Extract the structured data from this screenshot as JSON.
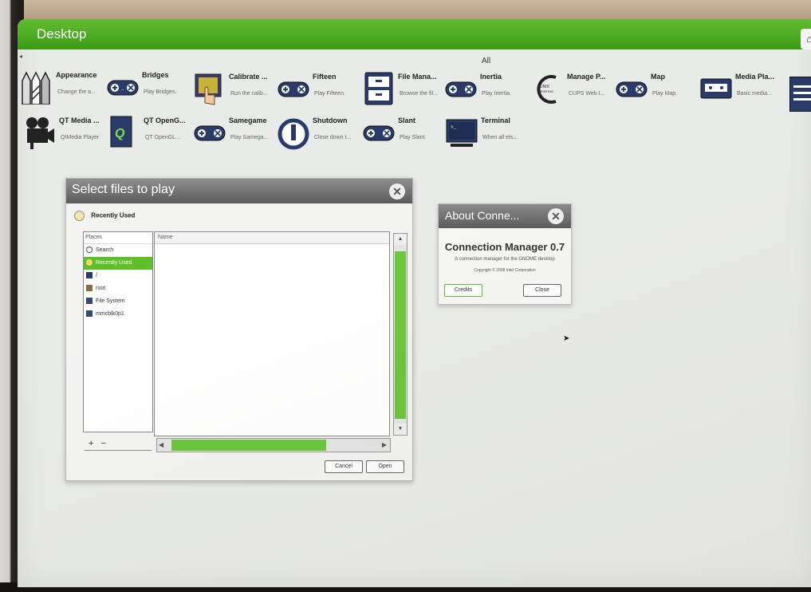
{
  "topbar": {
    "title": "Desktop",
    "right_button": "⌂"
  },
  "category": "All",
  "apps": [
    {
      "name": "Appearance",
      "desc": "Change the a...",
      "icon": "appearance-icon"
    },
    {
      "name": "Bridges",
      "desc": "Play Bridges.",
      "icon": "gamepad-icon"
    },
    {
      "name": "Calibrate ...",
      "desc": "Run the calib...",
      "icon": "calibrate-icon"
    },
    {
      "name": "Fifteen",
      "desc": "Play Fifteen.",
      "icon": "gamepad-icon"
    },
    {
      "name": "File Mana...",
      "desc": "Browse the fil...",
      "icon": "file-cabinet-icon"
    },
    {
      "name": "Inertia",
      "desc": "Play Inertia.",
      "icon": "gamepad-icon"
    },
    {
      "name": "Manage P...",
      "desc": "CUPS Web I...",
      "icon": "printing-system-icon"
    },
    {
      "name": "Map",
      "desc": "Play Map.",
      "icon": "gamepad-icon"
    },
    {
      "name": "Media Pla...",
      "desc": "Basic media...",
      "icon": "media-player-icon"
    },
    {
      "name": "QT Media ...",
      "desc": "QtMedia Player",
      "icon": "camera-icon"
    },
    {
      "name": "QT OpenG...",
      "desc": "QT OpenGL...",
      "icon": "opengl-icon"
    },
    {
      "name": "Samegame",
      "desc": "Play Samega...",
      "icon": "gamepad-icon"
    },
    {
      "name": "Shutdown",
      "desc": "Close down t...",
      "icon": "power-icon"
    },
    {
      "name": "Slant",
      "desc": "Play Slant.",
      "icon": "gamepad-icon"
    },
    {
      "name": "Terminal",
      "desc": "When all els...",
      "icon": "terminal-icon"
    }
  ],
  "file_dialog": {
    "title": "Select files to play",
    "location": "Recently Used",
    "places_header": "Places",
    "places": [
      "Search",
      "Recently Used",
      "/",
      "root",
      "File System",
      "mmcblk0p1"
    ],
    "selected_place": "Recently Used",
    "column_name": "Name",
    "add_label": "+",
    "remove_label": "−",
    "cancel_label": "Cancel",
    "open_label": "Open"
  },
  "about_dialog": {
    "title": "About Conne...",
    "app_name": "Connection Manager 0.7",
    "description": "A connection manager for the GNOME desktop",
    "copyright": "Copyright © 2008 Intel Corporation",
    "credits_label": "Credits",
    "close_label": "Close"
  },
  "colors": {
    "accent": "#4fae23",
    "dialog_header": "#6a6a6a"
  }
}
